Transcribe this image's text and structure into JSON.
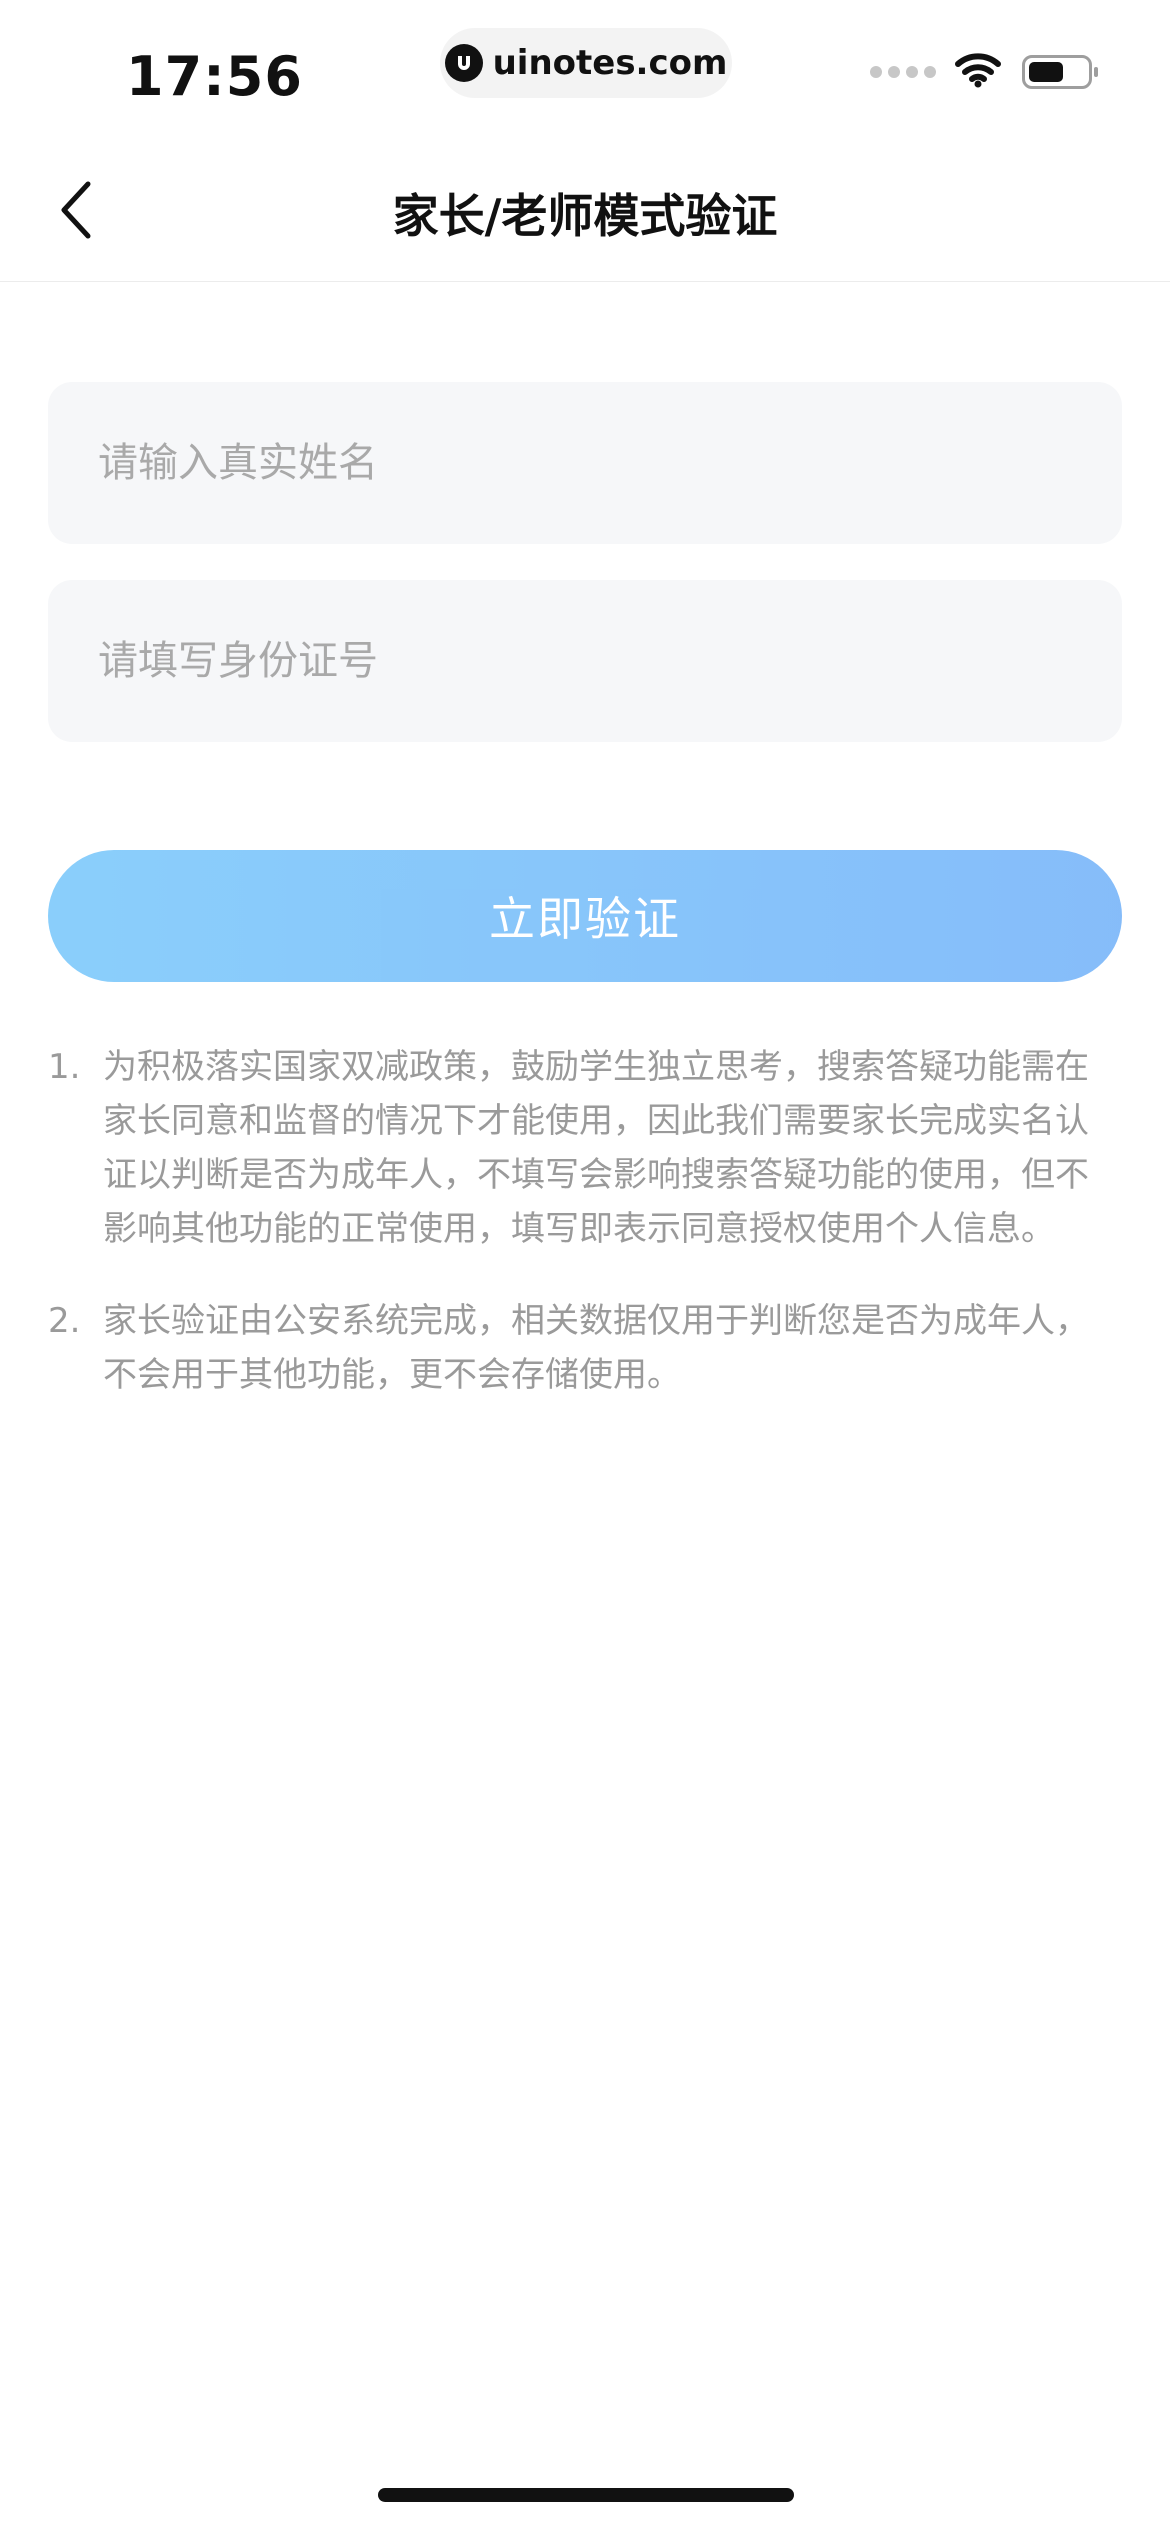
{
  "status_bar": {
    "time": "17:56",
    "url": "uinotes.com",
    "icons": [
      "signal-dots-icon",
      "wifi-icon",
      "battery-icon"
    ]
  },
  "nav": {
    "title": "家长/老师模式验证",
    "back_icon": "chevron-left-icon"
  },
  "form": {
    "name_placeholder": "请输入真实姓名",
    "name_value": "",
    "id_placeholder": "请填写身份证号",
    "id_value": "",
    "verify_label": "立即验证"
  },
  "notes": [
    {
      "num": "1.",
      "text": "为积极落实国家双减政策，鼓励学生独立思考，搜索答疑功能需在家长同意和监督的情况下才能使用，因此我们需要家长完成实名认证以判断是否为成年人，不填写会影响搜索答疑功能的使用，但不影响其他功能的正常使用，填写即表示同意授权使用个人信息。"
    },
    {
      "num": "2.",
      "text": "家长验证由公安系统完成，相关数据仅用于判断您是否为成年人，不会用于其他功能，更不会存储使用。"
    }
  ],
  "colors": {
    "button_gradient_start": "#84ccfb",
    "button_gradient_end": "#7fb9f9",
    "field_bg": "#f6f7f9",
    "note_text": "#9a9a9a"
  }
}
